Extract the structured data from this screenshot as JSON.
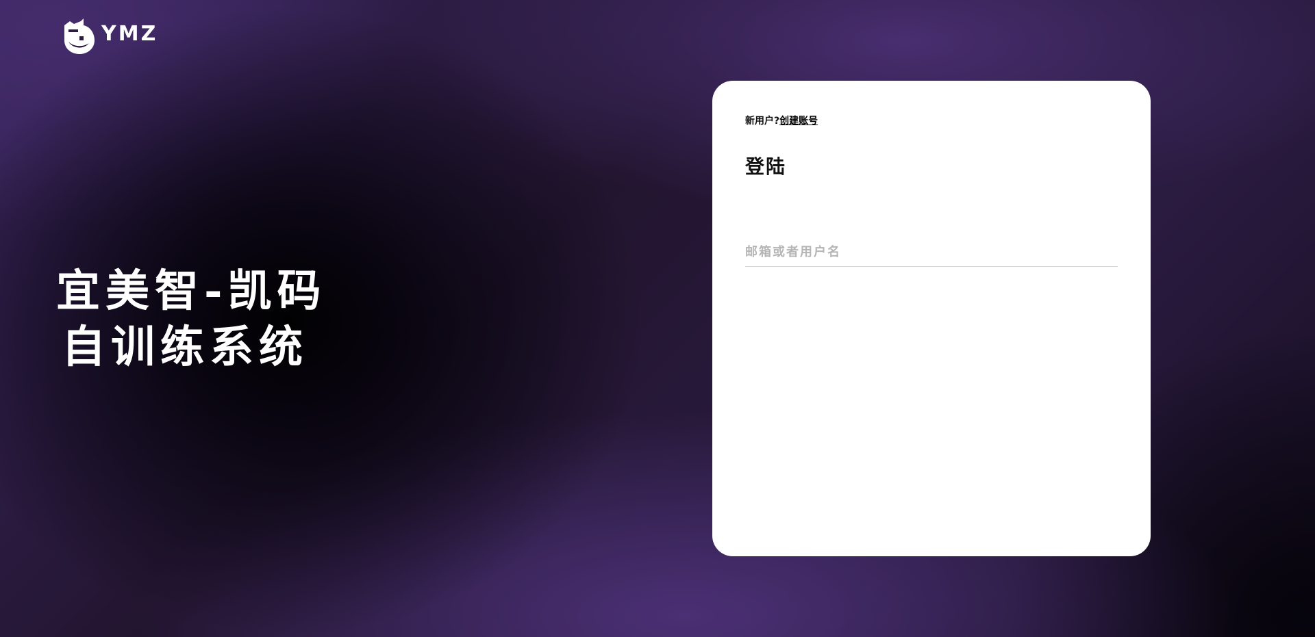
{
  "brand": {
    "logo_icon": "ymz-cat-logo-icon",
    "name": "YMZ"
  },
  "hero": {
    "line1": "宜美智-凯码",
    "line2": "自训练系统"
  },
  "login": {
    "new_user_prompt": "新用户?",
    "create_account_link": "创建账号",
    "title": "登陆",
    "username_field": {
      "value": "",
      "placeholder": "邮箱或者用户名"
    }
  },
  "colors": {
    "background_purple": "#3a2660",
    "background_dark": "#050308",
    "card": "#ffffff",
    "text_primary": "#111111",
    "placeholder": "#b5b5b5"
  }
}
